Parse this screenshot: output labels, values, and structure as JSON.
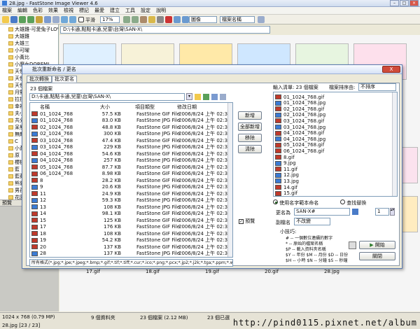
{
  "app": {
    "title": "28.jpg - FastStone Image Viewer 4.6",
    "filename": "28.jpg",
    "appname": "FastStone Image Viewer 4.6"
  },
  "menubar": [
    "檔案",
    "編輯",
    "色彩",
    "效果",
    "檢視",
    "標記",
    "最愛",
    "建立",
    "工具",
    "設定",
    "說明"
  ],
  "toolbar": {
    "zoom": "17%",
    "fit_label": "平滑",
    "view_mode": "圖像",
    "sort_by": "檔案名稱"
  },
  "tree": {
    "items": [
      "大雄雞-可愛兔子LOVE",
      "大雄雞",
      "大雄三",
      "小可曜",
      "小黃比",
      "小魔女DOREMI",
      "天使小魔曲",
      "天使",
      "天使小",
      "月野",
      "拉拉熊",
      "幸福",
      "夫小黃",
      "共分天",
      "呆熊",
      "無敵",
      "C",
      "小黃",
      "原",
      "櫻桃",
      "藍",
      "藍蘋",
      "熊貓",
      "男孩",
      "花園",
      "鴨蛋"
    ]
  },
  "preview_label": "預覽",
  "browser": {
    "path": "D:\\卡通,點點卡通,兒童\\台灣\\SAN-X\\",
    "captions": [
      "17.gif",
      "18.gif",
      "19.gif",
      "20.gif",
      "28.jpg"
    ]
  },
  "dialog": {
    "title": "批次重新命名 / 更名",
    "close": "X",
    "tabs": [
      "批次轉換",
      "批次更名"
    ],
    "file_count": "23 個檔案",
    "source_path": "D:\\卡通,點點卡通,兒童\\台灣\\SAN-X\\",
    "columns": [
      "名稱",
      "大小",
      "項目類型",
      "修改日期"
    ],
    "files": [
      {
        "name": "01_1024_768",
        "size": "57.5 KB",
        "type": "FastStone GIF File",
        "date": "2006/8/24 上午 02:35"
      },
      {
        "name": "01_1024_768",
        "size": "83.0 KB",
        "type": "FastStone JPG File",
        "date": "2006/8/24 上午 02:35"
      },
      {
        "name": "02_1024_768",
        "size": "48.8 KB",
        "type": "FastStone GIF File",
        "date": "2006/8/24 上午 02:35"
      },
      {
        "name": "02_1024_768",
        "size": "300 KB",
        "type": "FastStone JPG File",
        "date": "2006/8/24 上午 02:35"
      },
      {
        "name": "03_1024_768",
        "size": "47.4 KB",
        "type": "FastStone GIF File",
        "date": "2006/8/24 上午 02:34"
      },
      {
        "name": "03_1024_768",
        "size": "229 KB",
        "type": "FastStone JPG File",
        "date": "2006/8/24 上午 02:34"
      },
      {
        "name": "04_1024_768",
        "size": "54.6 KB",
        "type": "FastStone GIF File",
        "date": "2006/8/24 上午 02:35"
      },
      {
        "name": "04_1024_768",
        "size": "257 KB",
        "type": "FastStone JPG File",
        "date": "2006/8/24 上午 02:35"
      },
      {
        "name": "05_1024_768",
        "size": "87.7 KB",
        "type": "FastStone GIF File",
        "date": "2006/8/24 上午 02:35"
      },
      {
        "name": "06_1024_768",
        "size": "8.98 KB",
        "type": "FastStone GIF File",
        "date": "2006/8/24 上午 02:36"
      },
      {
        "name": "8",
        "size": "28.2 KB",
        "type": "FastStone GIF File",
        "date": "2006/8/24 上午 02:36"
      },
      {
        "name": "9",
        "size": "20.6 KB",
        "type": "FastStone JPG File",
        "date": "2006/8/24 上午 02:36"
      },
      {
        "name": "11",
        "size": "24.9 KB",
        "type": "FastStone GIF File",
        "date": "2006/8/24 上午 02:36"
      },
      {
        "name": "12",
        "size": "59.3 KB",
        "type": "FastStone JPG File",
        "date": "2006/8/24 上午 02:36"
      },
      {
        "name": "13",
        "size": "108 KB",
        "type": "FastStone JPG File",
        "date": "2006/8/24 上午 02:37"
      },
      {
        "name": "14",
        "size": "98.1 KB",
        "type": "FastStone GIF File",
        "date": "2006/8/24 上午 02:37"
      },
      {
        "name": "15",
        "size": "125 KB",
        "type": "FastStone GIF File",
        "date": "2006/8/24 上午 02:37"
      },
      {
        "name": "17",
        "size": "176 KB",
        "type": "FastStone GIF File",
        "date": "2006/8/24 上午 02:37"
      },
      {
        "name": "18",
        "size": "108 KB",
        "type": "FastStone GIF File",
        "date": "2006/8/24 上午 02:37"
      },
      {
        "name": "19",
        "size": "54.2 KB",
        "type": "FastStone GIF File",
        "date": "2006/8/24 上午 02:37"
      },
      {
        "name": "20",
        "size": "137 KB",
        "type": "FastStone GIF File",
        "date": "2006/8/24 上午 02:37"
      },
      {
        "name": "28",
        "size": "137 KB",
        "type": "FastStone JPG File",
        "date": "2006/8/24 上午 02:37"
      }
    ],
    "filter": "所有格式(*.jpg;*.jpe;*.jpeg;*.bmp;*.gif;*.tif;*.tiff;*.cur;*.ico;*.png;*.pcx;*.jp2;*.j2k;*.tga;*.ppm;*.wmf;*.psd;*.emf)",
    "buttons": {
      "add": "新增",
      "add_all": "全部新增",
      "remove": "移除",
      "clear": "清除"
    },
    "preview_check": "預覽",
    "output": {
      "label": "輸入清單: 23 個檔案",
      "sort_label": "檔案排序由:",
      "sort_value": "不排序",
      "files": [
        "01_1024_768.gif",
        "01_1024_768.jpg",
        "02_1024_768.gif",
        "02_1024_768.jpg",
        "03_1024_768.gif",
        "03_1024_768.jpg",
        "04_1024_768.gif",
        "04_1024_768.jpg",
        "05_1024_768.gif",
        "06_1024_768.gif",
        "8.gif",
        "9.jpg",
        "11.gif",
        "12.jpg",
        "13.jpg",
        "14.gif",
        "15.gif"
      ]
    },
    "rename_mode": {
      "option1": "使用名字範本命名",
      "option2": "查找替換"
    },
    "template": {
      "label": "更名為",
      "value": "SAN-X#",
      "start": "1"
    },
    "ext": {
      "label": "副檔名",
      "value": "不改變"
    },
    "tips": {
      "title": "小技巧:",
      "lines": [
        "# -- 一個數位連續的數字",
        "* -- 原始的檔案名稱",
        "$P -- 載入資料夾名稱",
        "$Y -- 年份    $M -- 月份    $D -- 日份",
        "$H -- 小時    $N -- 分鐘    $S -- 秒鐘"
      ]
    },
    "start_btn": "開始",
    "close_btn": "關閉"
  },
  "statusbar": {
    "info": "1024 x 768 (0.79 MP)",
    "selected": "9 個資料夾",
    "files": "23 個檔案 (2.12 MB)",
    "chosen": "23 個已選",
    "footer": "28.jpg [23 / 23]"
  },
  "watermark": "http://pind0115.pixnet.net/album"
}
